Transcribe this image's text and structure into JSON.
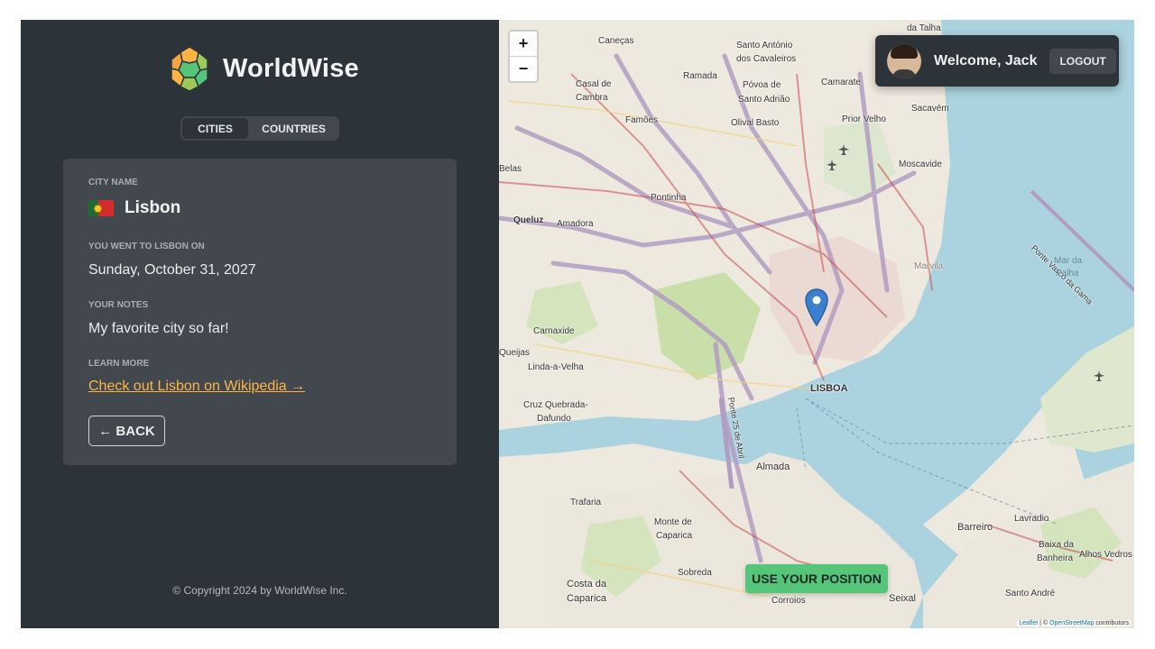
{
  "brand": {
    "name": "WorldWise"
  },
  "tabs": [
    {
      "label": "CITIES"
    },
    {
      "label": "COUNTRIES"
    }
  ],
  "city": {
    "name_label": "City name",
    "name": "Lisbon",
    "date_label": "You went to Lisbon on",
    "date": "Sunday, October 31, 2027",
    "notes_label": "Your notes",
    "notes": "My favorite city so far!",
    "learn_label": "Learn more",
    "wiki_link": "Check out Lisbon on Wikipedia →",
    "back": "← BACK"
  },
  "footer": {
    "copyright": "© Copyright 2024 by WorldWise Inc."
  },
  "map": {
    "zoom_in": "+",
    "zoom_out": "−",
    "use_position": "USE YOUR POSITION",
    "attribution_leaflet": "Leaflet",
    "attribution_sep": " | © ",
    "attribution_osm": "OpenStreetMap",
    "attribution_tail": " contributors",
    "labels": {
      "dt": "da Talha",
      "canecas": "Caneças",
      "santo1": "Santo António",
      "santo2": "dos Cavaleiros",
      "ramada": "Ramada",
      "casal1": "Casal de",
      "casal2": "Cambra",
      "povoa1": "Póvoa de",
      "povoa2": "Santo Adrião",
      "camarate": "Camarate",
      "sacavem": "Sacavém",
      "famoes": "Famões",
      "olival": "Olival Basto",
      "prior": "Prior Velho",
      "belas": "Belas",
      "moscavide": "Moscavide",
      "pontinha": "Pontinha",
      "queluz": "Queluz",
      "amadora": "Amadora",
      "vasco": "Ponte Vasco da Gama",
      "mar1": "Mar da",
      "mar2": "Palha",
      "marvila": "Marvila",
      "carnaxide": "Carnaxide",
      "queijas": "Queijas",
      "linda": "Linda-a-Velha",
      "lisboa": "LISBOA",
      "cruz1": "Cruz Quebrada-",
      "cruz2": "Dafundo",
      "ponte25": "Ponte 25 de Abril",
      "almada": "Almada",
      "trafaria": "Trafaria",
      "monte1": "Monte de",
      "monte2": "Caparica",
      "barreiro": "Barreiro",
      "lavradio": "Lavradio",
      "baixa1": "Baixa da",
      "baixa2": "Banheira",
      "alhos": "Alhos Vedros",
      "sobreda": "Sobreda",
      "costa1": "Costa da",
      "costa2": "Caparica",
      "corroios": "Corroios",
      "seixal": "Seixal",
      "santoandre": "Santo André"
    }
  },
  "user": {
    "welcome": "Welcome, Jack",
    "logout": "LOGOUT"
  },
  "colors": {
    "sidebar": "#2d3439",
    "card": "#42484d",
    "accent_orange": "#ffb545",
    "accent_green": "#55c57a",
    "water": "#aad3df"
  }
}
